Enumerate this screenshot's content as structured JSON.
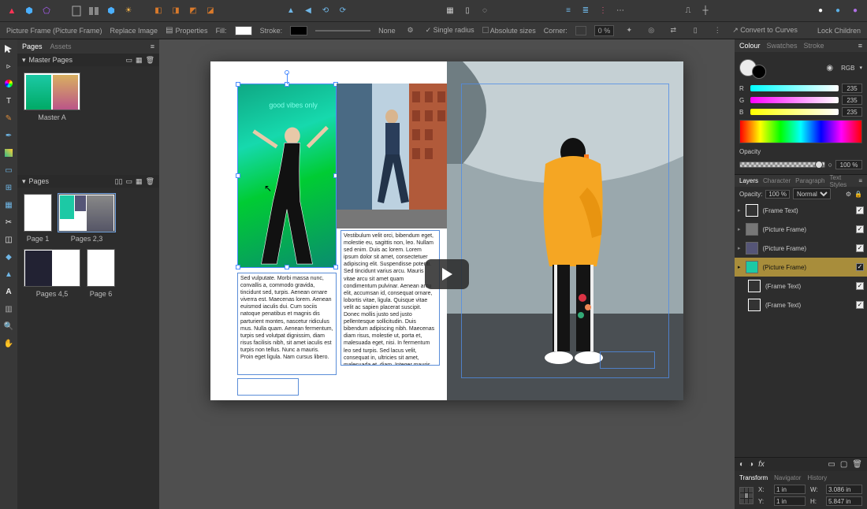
{
  "context": {
    "object_label": "Picture Frame  (Picture Frame)",
    "replace_image": "Replace Image",
    "properties": "Properties",
    "fill_label": "Fill:",
    "stroke_label": "Stroke:",
    "stroke_value": "None",
    "single_radius": "Single radius",
    "absolute_sizes": "Absolute sizes",
    "corner_label": "Corner:",
    "corner_value": "0 %",
    "convert": "Convert to Curves",
    "lock_children": "Lock Children"
  },
  "pages_panel": {
    "tab_pages": "Pages",
    "tab_assets": "Assets",
    "master_pages": "Master Pages",
    "master_a": "Master A",
    "pages_header": "Pages",
    "page1": "Page 1",
    "pages23": "Pages 2,3",
    "pages45": "Pages 4,5",
    "page6": "Page 6"
  },
  "colour": {
    "tab_colour": "Colour",
    "tab_swatches": "Swatches",
    "tab_stroke": "Stroke",
    "mode": "RGB",
    "r": "R",
    "g": "G",
    "b": "B",
    "r_val": "235",
    "g_val": "235",
    "b_val": "235",
    "opacity_label": "Opacity",
    "opacity_value": "100 %"
  },
  "layers": {
    "tab_layers": "Layers",
    "tab_character": "Character",
    "tab_paragraph": "Paragraph",
    "tab_textstyles": "Text Styles",
    "opacity_label": "Opacity:",
    "opacity_value": "100 %",
    "blend": "Normal",
    "items": [
      {
        "name": "(Frame Text)"
      },
      {
        "name": "(Picture Frame)"
      },
      {
        "name": "(Picture Frame)"
      },
      {
        "name": "(Picture Frame)"
      },
      {
        "name": "(Frame Text)"
      },
      {
        "name": "(Frame Text)"
      }
    ]
  },
  "transform": {
    "tab_transform": "Transform",
    "tab_navigator": "Navigator",
    "tab_history": "History",
    "x_label": "X:",
    "x_val": "1 in",
    "y_label": "Y:",
    "y_val": "1 in",
    "w_label": "W:",
    "w_val": "3.086 in",
    "h_label": "H:",
    "h_val": "5.847 in"
  },
  "frame_text": {
    "left": "Sed vulputate. Morbi massa nunc, convallis a, commodo gravida, tincidunt sed, turpis. Aenean ornare viverra est. Maecenas lorem. Aenean euismod iaculis dui. Cum sociis natoque penatibus et magnis dis parturient montes, nascetur ridiculus mus. Nulla quam. Aenean fermentum, turpis sed volutpat dignissim, diam risus facilisis nibh, sit amet iaculis est turpis non tellus. Nunc a mauris. Proin eget ligula. Nam cursus libero.",
    "right": "Vestibulum velit orci, bibendum eget, molestie eu, sagittis non, leo. Nullam sed enim. Duis ac lorem. Lorem ipsum dolor sit amet, consectetuer adipiscing elit. Suspendisse potenti. Sed tincidunt varius arcu. Mauris vitae arcu sit amet quam condimentum pulvinar. Aenean arcu elit, accumsan id, consequat ornare, lobortis vitae, ligula. Quisque vitae velit ac sapien placerat suscipit. Donec mollis justo sed justo pellentesque sollicitudin. Duis bibendum adipiscing nibh. Maecenas diam risus, molestie ut, porta et, malesuada eget, nisi. In fermentum leo sed turpis. Sed lacus velit, consequat in, ultricies sit amet, malesuada et, diam. Integer mauris sem, convallis ut."
  }
}
